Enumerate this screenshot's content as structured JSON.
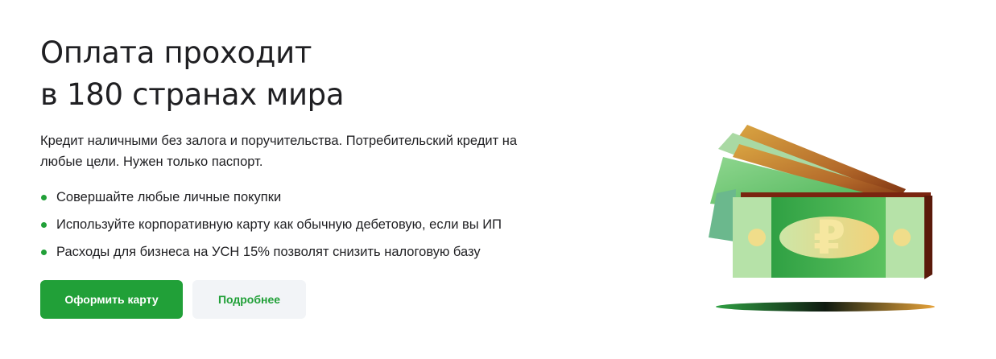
{
  "hero": {
    "title_line1": "Оплата проходит",
    "title_line2": "в 180 странах мира",
    "description": "Кредит наличными без залога и поручительства. Потребительский кредит на любые цели. Нужен только паспорт.",
    "features": [
      "Совершайте любые личные покупки",
      "Используйте корпоративную карту как обычную дебетовую, если вы ИП",
      "Расходы для бизнеса на УСН 15% позволят снизить налоговую базу"
    ]
  },
  "buttons": {
    "primary_label": "Оформить карту",
    "secondary_label": "Подробнее"
  },
  "illustration": {
    "icon": "ruble-banknotes-illustration",
    "currency_symbol": "₽"
  },
  "colors": {
    "accent": "#21a038",
    "text": "#1f1f22",
    "secondary_button_bg": "#f2f4f7"
  }
}
